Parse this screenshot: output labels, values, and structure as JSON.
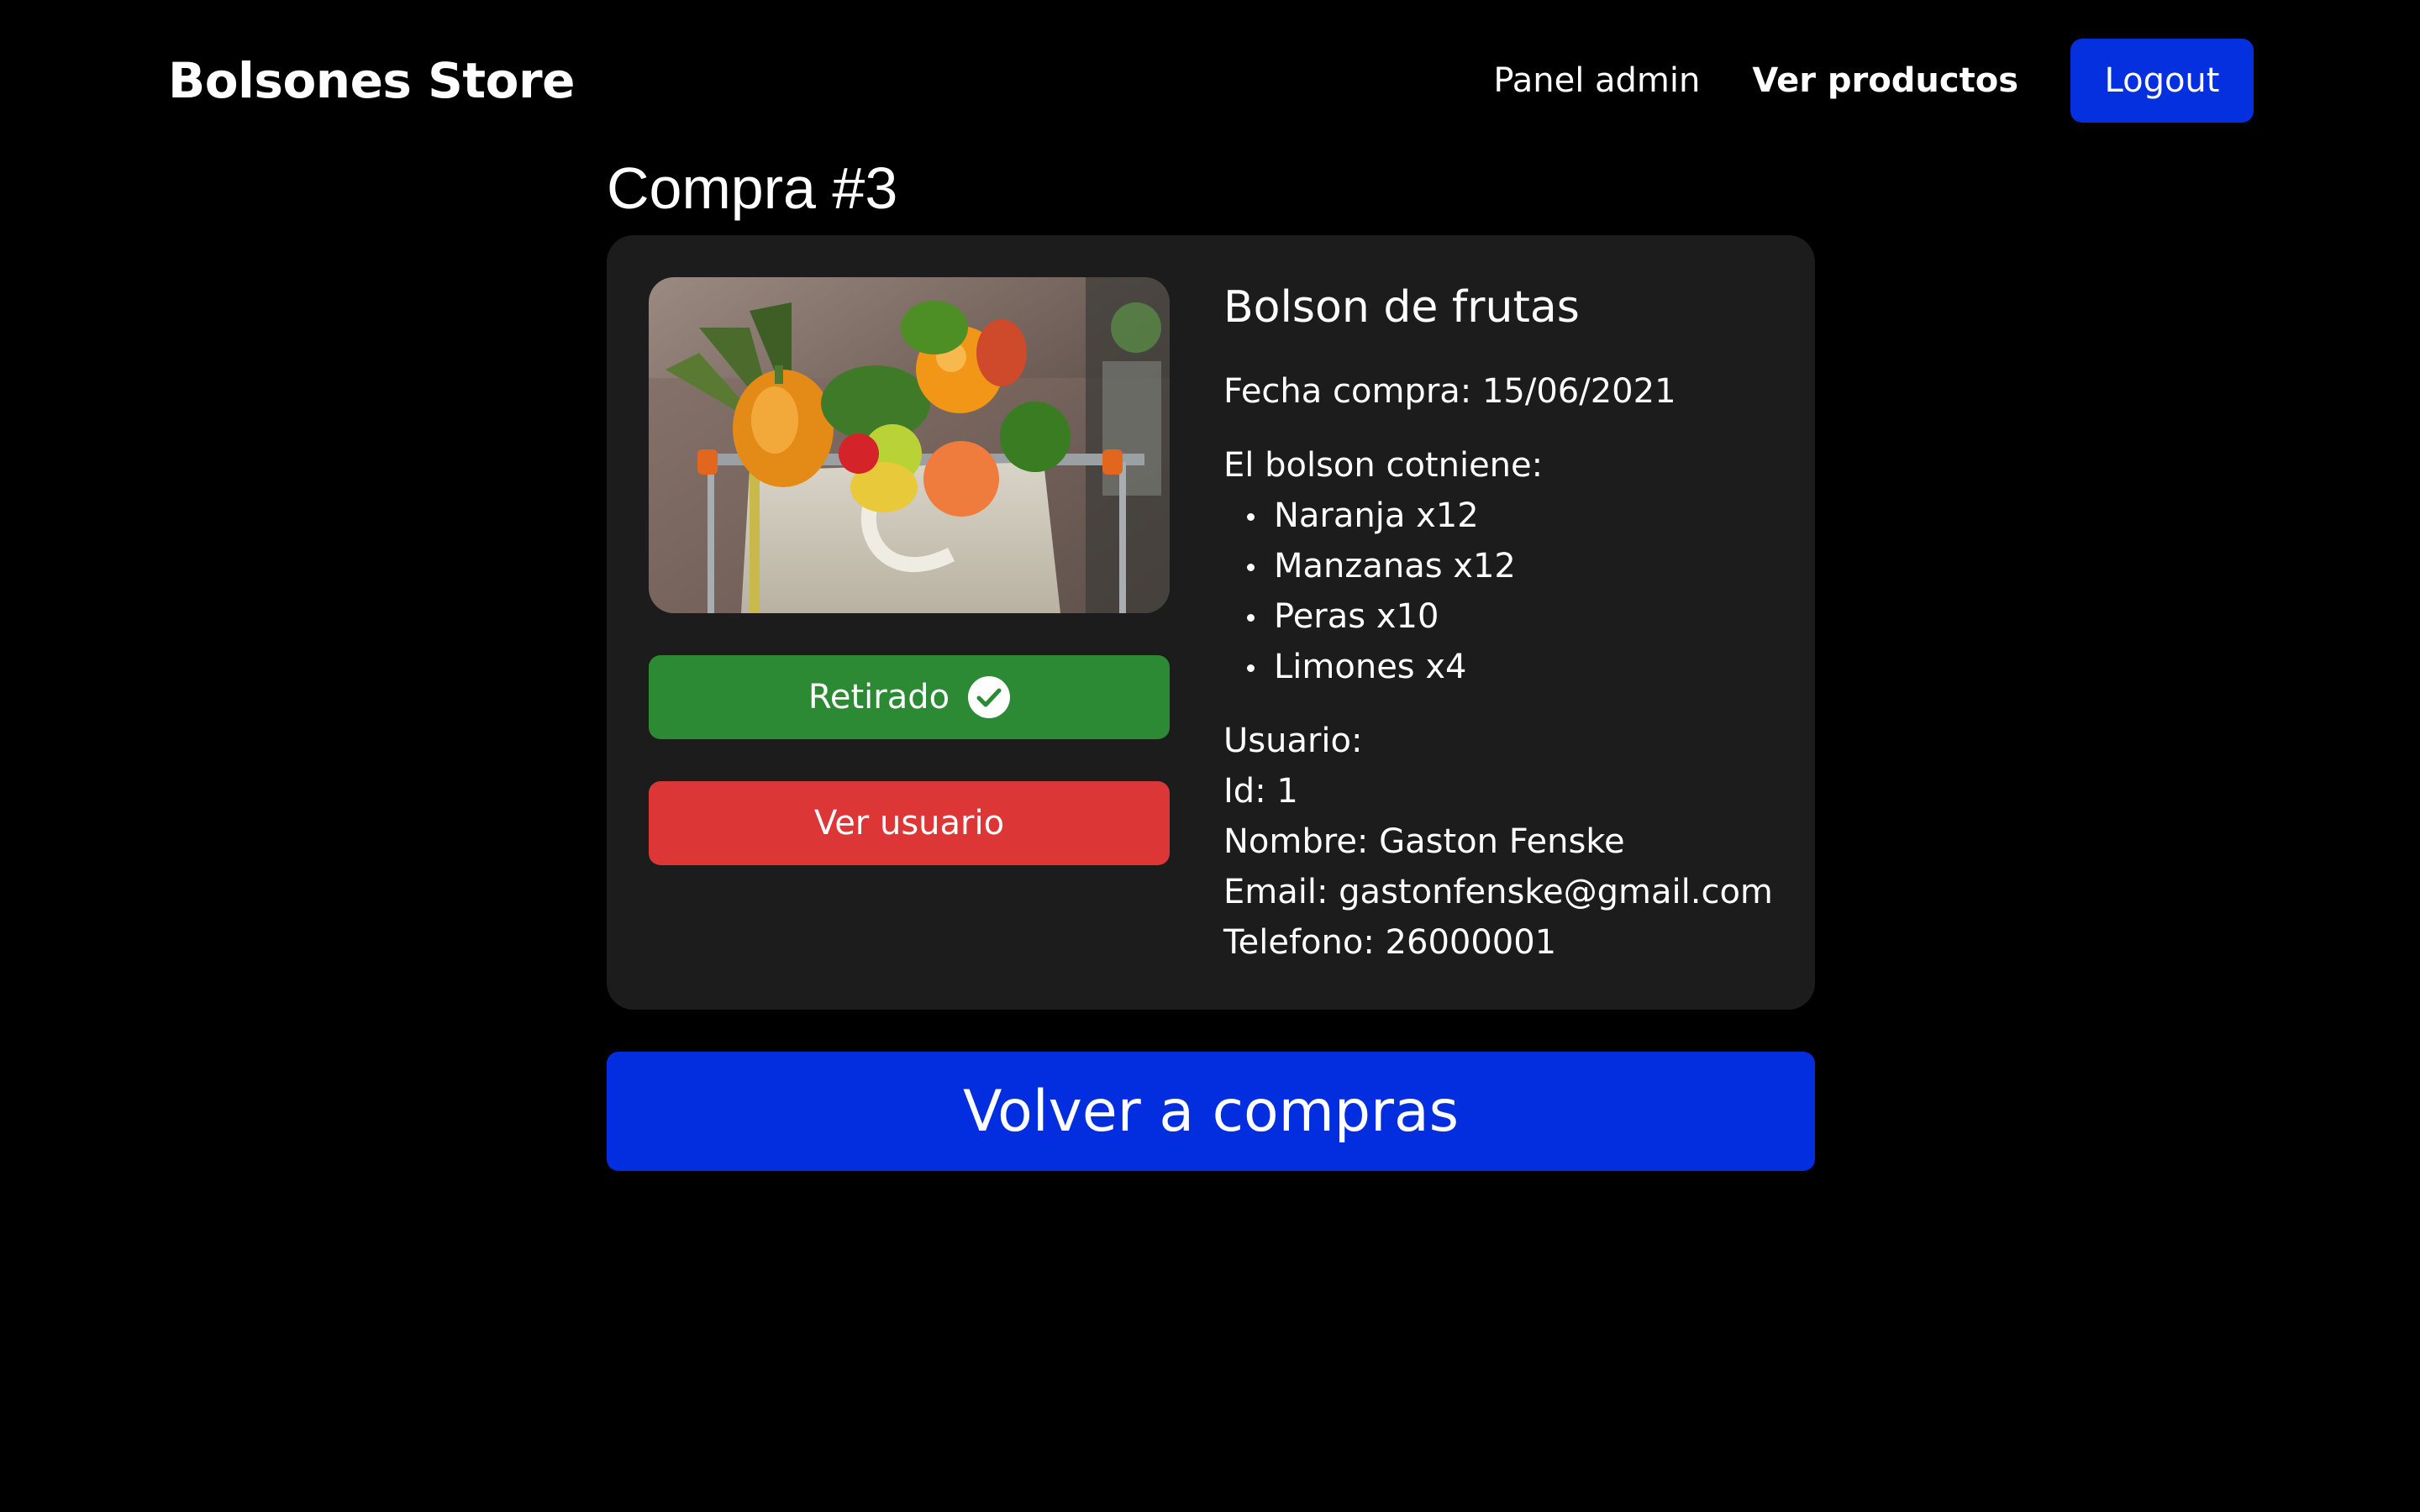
{
  "navbar": {
    "brand": "Bolsones Store",
    "links": [
      "Panel admin",
      "Ver productos"
    ],
    "logout_label": "Logout"
  },
  "order": {
    "title": "Compra #3"
  },
  "product": {
    "name": "Bolson de frutas",
    "purchase_date": "Fecha compra: 15/06/2021",
    "contents_label": "El bolson cotniene:",
    "items": [
      "Naranja x12",
      "Manzanas x12",
      "Peras x10",
      "Limones x4"
    ]
  },
  "user": {
    "heading": "Usuario:",
    "id": "Id: 1",
    "name": "Nombre: Gaston Fenske",
    "email": "Email: gastonfenske@gmail.com",
    "phone": "Telefono: 26000001"
  },
  "actions": {
    "status_label": "Retirado",
    "view_user_label": "Ver usuario",
    "back_label": "Volver a compras"
  },
  "colors": {
    "background": "#000000",
    "card": "#1c1c1c",
    "primary_blue": "#0430e0",
    "success_green": "#2b8a33",
    "danger_red": "#dc3636"
  },
  "icons": {
    "status": "check-circle-icon"
  }
}
